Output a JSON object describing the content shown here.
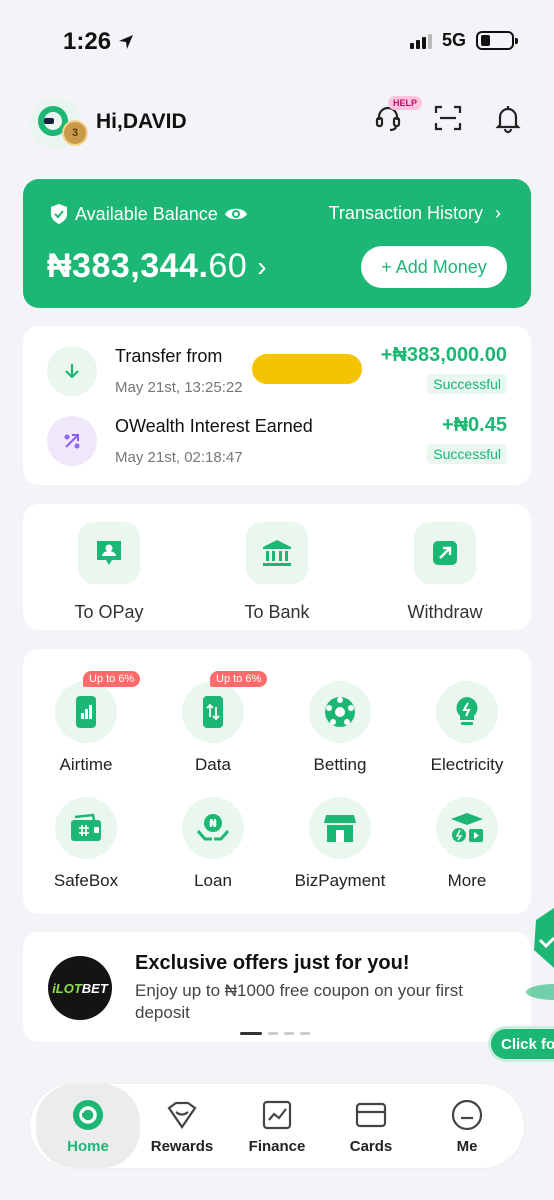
{
  "status_bar": {
    "time": "1:26",
    "network": "5G"
  },
  "header": {
    "greeting": "Hi,DAVID",
    "medal_level": "3",
    "help_badge": "HELP"
  },
  "balance": {
    "label": "Available Balance",
    "transaction_history": "Transaction History",
    "amount_main": "₦383,344.",
    "amount_cents": "60",
    "add_money": "+ Add Money"
  },
  "transactions": [
    {
      "title": "Transfer from",
      "title_suffix": "...",
      "date": "May 21st, 13:25:22",
      "amount": "+₦383,000.00",
      "status": "Successful"
    },
    {
      "title": "OWealth Interest Earned",
      "title_suffix": "",
      "date": "May 21st, 02:18:47",
      "amount": "+₦0.45",
      "status": "Successful"
    }
  ],
  "transfer_actions": [
    {
      "label": "To OPay",
      "icon": "person-chat-icon"
    },
    {
      "label": "To Bank",
      "icon": "bank-icon"
    },
    {
      "label": "Withdraw",
      "icon": "withdraw-icon"
    }
  ],
  "services": [
    {
      "label": "Airtime",
      "icon": "phone-signal-icon",
      "promo": "Up to 6%"
    },
    {
      "label": "Data",
      "icon": "phone-data-icon",
      "promo": "Up to 6%"
    },
    {
      "label": "Betting",
      "icon": "football-icon",
      "promo": ""
    },
    {
      "label": "Electricity",
      "icon": "bulb-icon",
      "promo": ""
    },
    {
      "label": "SafeBox",
      "icon": "wallet-icon",
      "promo": ""
    },
    {
      "label": "Loan",
      "icon": "naira-hand-icon",
      "promo": ""
    },
    {
      "label": "BizPayment",
      "icon": "shop-icon",
      "promo": ""
    },
    {
      "label": "More",
      "icon": "more-icon",
      "promo": ""
    }
  ],
  "offer": {
    "logo_text_a": "iLOT",
    "logo_text_b": "BET",
    "title": "Exclusive offers just for you!",
    "text": "Enjoy up to ₦1000 free coupon on your first deposit"
  },
  "floating_button": "Click for",
  "nav": [
    {
      "label": "Home",
      "icon": "home-icon",
      "active": true
    },
    {
      "label": "Rewards",
      "icon": "rewards-icon",
      "active": false
    },
    {
      "label": "Finance",
      "icon": "finance-icon",
      "active": false
    },
    {
      "label": "Cards",
      "icon": "card-icon",
      "active": false
    },
    {
      "label": "Me",
      "icon": "profile-icon",
      "active": false
    }
  ],
  "colors": {
    "brand": "#1cb774",
    "promo": "#ff6b6b",
    "redaction": "#f5c400"
  }
}
